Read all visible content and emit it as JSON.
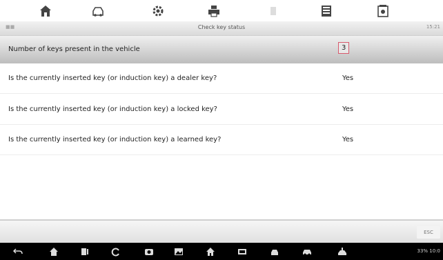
{
  "toolbar": {
    "icons": [
      "home-icon",
      "vehicle-icon",
      "gear-icon",
      "print-icon",
      "blank-icon",
      "save-icon",
      "screenshot-icon"
    ]
  },
  "titlebar": {
    "title": "Check key status",
    "time": "15:21"
  },
  "rows": [
    {
      "question": "Number of keys present in the vehicle",
      "answer": "3"
    },
    {
      "question": "Is the currently inserted key (or induction key) a dealer key?",
      "answer": "Yes"
    },
    {
      "question": "Is the currently inserted key (or induction key) a locked key?",
      "answer": "Yes"
    },
    {
      "question": "Is the currently inserted key (or induction key) a learned key?",
      "answer": "Yes"
    }
  ],
  "footer": {
    "esc_label": "ESC"
  },
  "navbar": {
    "status": "33% 10:0"
  },
  "colors": {
    "highlight_border": "#d8586c",
    "nav_bg": "#000000"
  }
}
